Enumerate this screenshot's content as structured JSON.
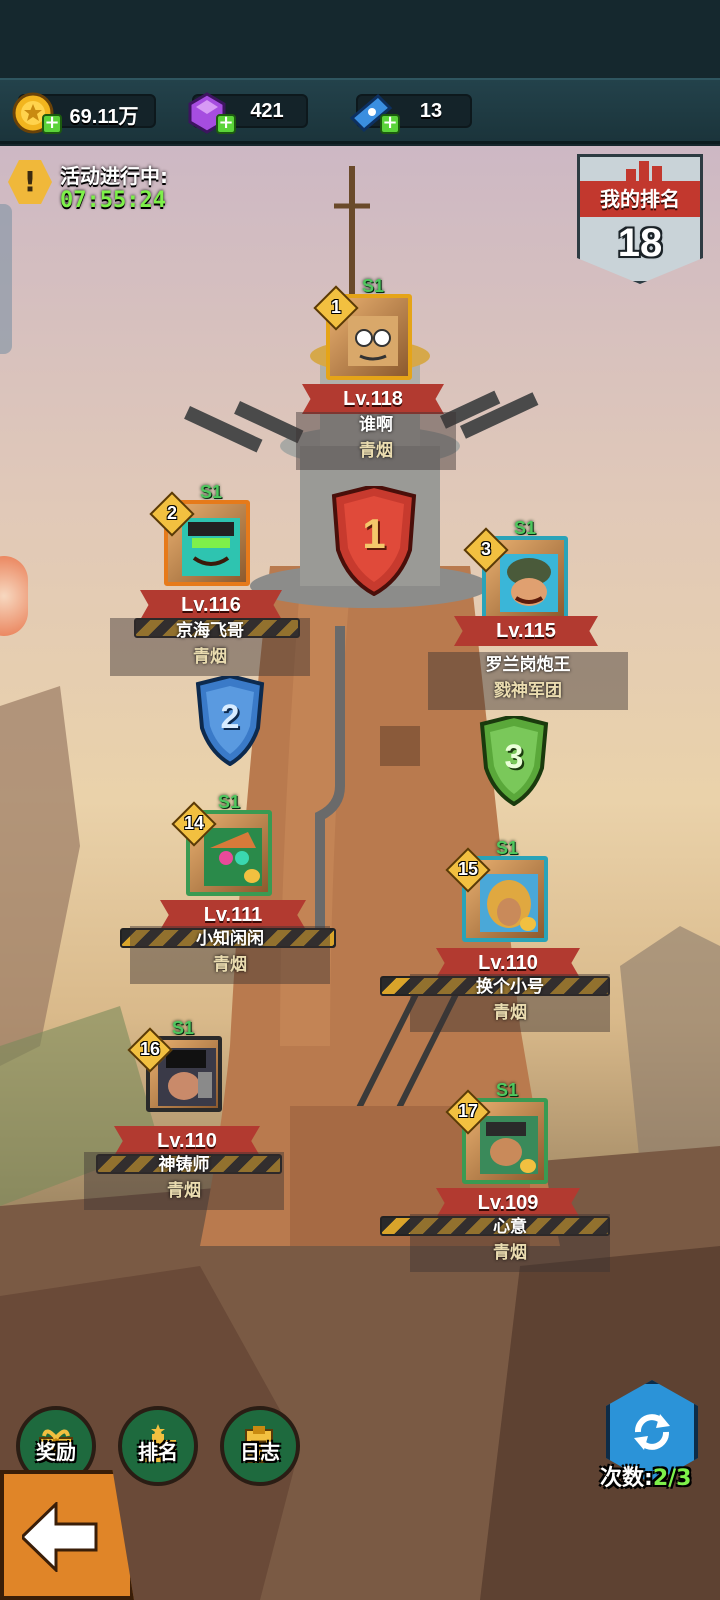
{
  "resources": {
    "gold": "69.11万",
    "gems": "421",
    "tickets": "13"
  },
  "event": {
    "status": "活动进行中:",
    "timer": "07:55:24"
  },
  "my_rank": {
    "label": "我的排名",
    "value": "18"
  },
  "podium": {
    "first": "1",
    "second": "2",
    "third": "3"
  },
  "players": [
    {
      "rank": "1",
      "season": "S1",
      "level": "Lv.118",
      "name": "谁啊",
      "guild": "青烟"
    },
    {
      "rank": "2",
      "season": "S1",
      "level": "Lv.116",
      "name": "京海飞哥",
      "guild": "青烟"
    },
    {
      "rank": "3",
      "season": "S1",
      "level": "Lv.115",
      "name": "罗兰岗炮王",
      "guild": "戮神军团"
    },
    {
      "rank": "14",
      "season": "S1",
      "level": "Lv.111",
      "name": "小知闲闲",
      "guild": "青烟"
    },
    {
      "rank": "15",
      "season": "S1",
      "level": "Lv.110",
      "name": "换个小号",
      "guild": "青烟"
    },
    {
      "rank": "16",
      "season": "S1",
      "level": "Lv.110",
      "name": "神铸师",
      "guild": "青烟"
    },
    {
      "rank": "17",
      "season": "S1",
      "level": "Lv.109",
      "name": "心意",
      "guild": "青烟"
    }
  ],
  "bottom": {
    "rewards": "奖励",
    "ranking": "排名",
    "log": "日志",
    "count_label": "次数:",
    "count_value": "2/3"
  },
  "colors": {
    "accent_green": "#7ef04a",
    "banner_red": "#b23a30",
    "gold": "#f2c040"
  }
}
